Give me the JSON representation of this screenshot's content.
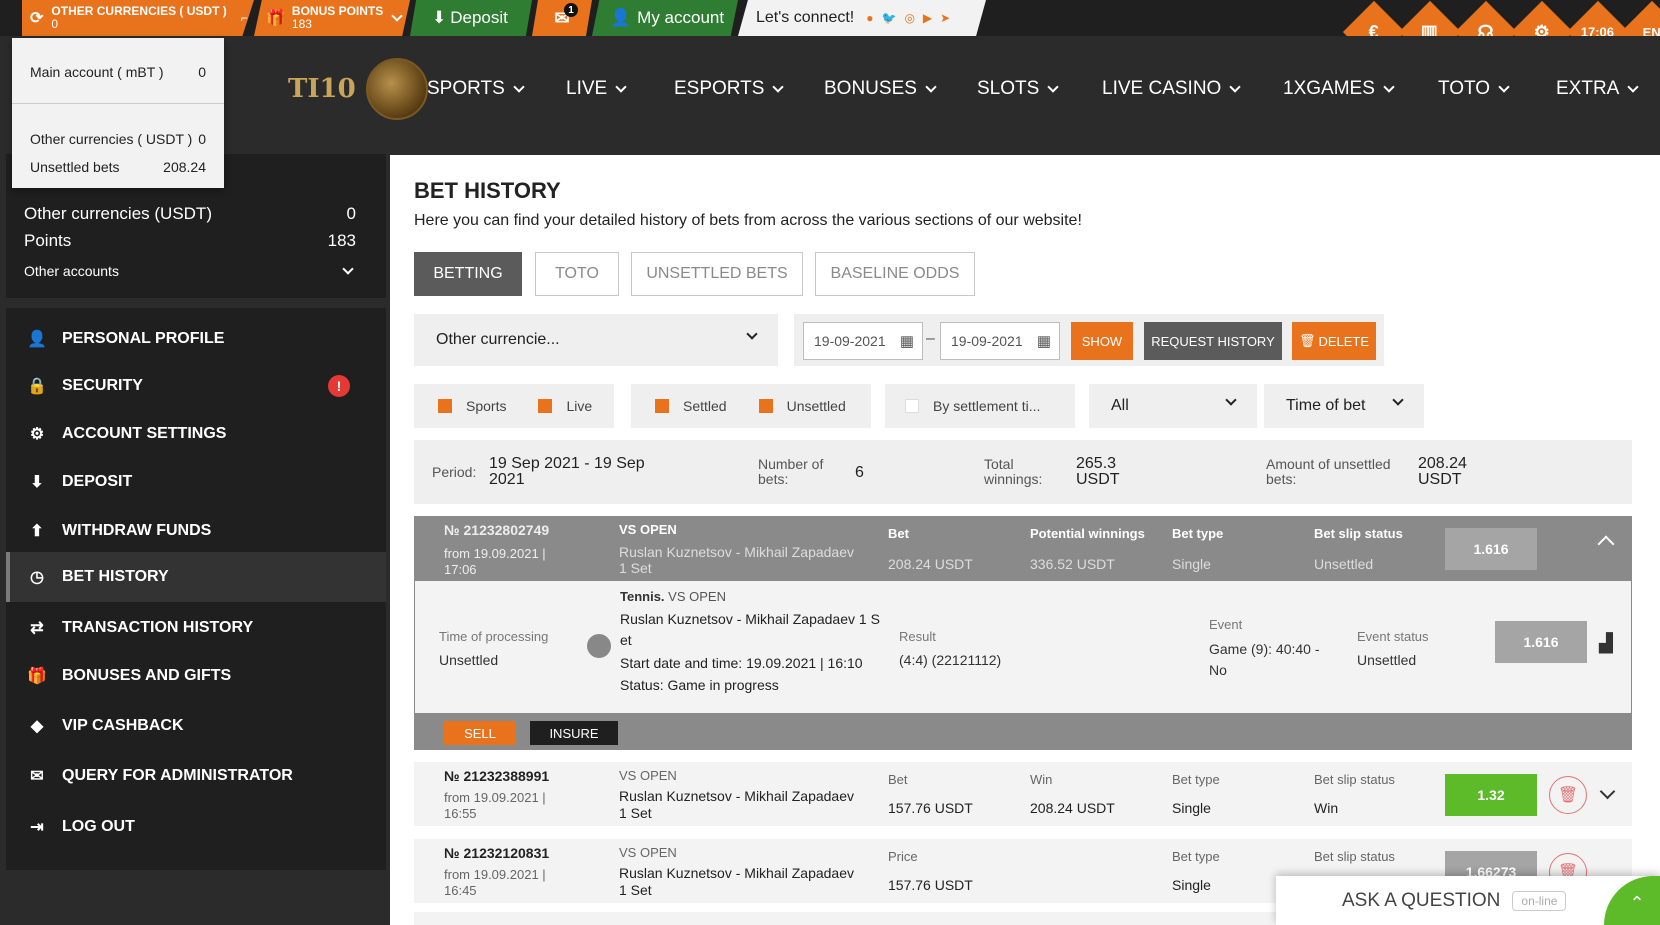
{
  "topbar": {
    "currencies_label": "OTHER CURRENCIES ( USDT )",
    "currencies_value": "0",
    "bonus_label": "BONUS POINTS",
    "bonus_value": "183",
    "deposit": "Deposit",
    "mail_badge": "1",
    "account": "My account",
    "connect": "Let's connect!",
    "corner": {
      "time": "17:06",
      "lang": "EN"
    }
  },
  "balance_dropdown": {
    "main_label": "Main account ( mBT )",
    "main_value": "0",
    "other_label": "Other currencies ( USDT )",
    "other_value": "0",
    "unsettled_label": "Unsettled bets",
    "unsettled_value": "208.24"
  },
  "logo": {
    "text": "TI10"
  },
  "menu": [
    "SPORTS",
    "LIVE",
    "ESPORTS",
    "BONUSES",
    "SLOTS",
    "LIVE CASINO",
    "1XGAMES",
    "TOTO",
    "EXTRA"
  ],
  "sidebar": {
    "other_currencies_label": "Other currencies (USDT)",
    "other_currencies_value": "0",
    "points_label": "Points",
    "points_value": "183",
    "other_accounts": "Other accounts",
    "items": [
      {
        "label": "Personal profile",
        "icon": "user-plus-icon"
      },
      {
        "label": "Security",
        "icon": "lock-icon"
      },
      {
        "label": "Account settings",
        "icon": "gears-icon"
      },
      {
        "label": "Deposit",
        "icon": "download-icon"
      },
      {
        "label": "Withdraw funds",
        "icon": "upload-icon"
      },
      {
        "label": "Bet history",
        "icon": "clock-icon"
      },
      {
        "label": "Transaction history",
        "icon": "arrows-icon"
      },
      {
        "label": "Bonuses and gifts",
        "icon": "gift-icon"
      },
      {
        "label": "VIP Cashback",
        "icon": "diamond-icon"
      },
      {
        "label": "Query for administrator",
        "icon": "envelope-icon"
      },
      {
        "label": "Log out",
        "icon": "logout-icon"
      }
    ],
    "security_alert": "!"
  },
  "page": {
    "title": "BET HISTORY",
    "subtitle": "Here you can find your detailed history of bets from across the various sections of our website!"
  },
  "tabs": [
    "BETTING",
    "TOTO",
    "UNSETTLED BETS",
    "BASELINE ODDS"
  ],
  "filters": {
    "currency": "Other currencie...",
    "date_from": "19-09-2021",
    "date_to": "19-09-2021",
    "show": "SHOW",
    "request_history": "REQUEST HISTORY",
    "delete": "DELETE",
    "sports": "Sports",
    "live": "Live",
    "settled": "Settled",
    "unsettled": "Unsettled",
    "by_settlement": "By settlement ti...",
    "all": "All",
    "time_of_bet": "Time of bet"
  },
  "summary": {
    "period_label": "Period:",
    "period_value": "19 Sep 2021 - 19 Sep 2021",
    "bets_label": "Number of bets:",
    "bets_value": "6",
    "winnings_label": "Total winnings:",
    "winnings_value": "265.3 USDT",
    "unsettled_label": "Amount of unsettled bets:",
    "unsettled_value": "208.24 USDT"
  },
  "bet1": {
    "number": "№ 21232802749",
    "date": "from 19.09.2021 | 17:06",
    "type_tag": "VS OPEN",
    "match": "Ruslan Kuznetsov - Mikhail Zapadaev 1 Set",
    "bet_label": "Bet",
    "bet_value": "208.24 USDT",
    "pw_label": "Potential winnings",
    "pw_value": "336.52 USDT",
    "bt_label": "Bet type",
    "bt_value": "Single",
    "status_label": "Bet slip status",
    "status_value": "Unsettled",
    "odds": "1.616",
    "detail": {
      "proc_label": "Time of processing",
      "proc_value": "Unsettled",
      "sport": "Tennis.",
      "tag": "VS OPEN",
      "match": "Ruslan Kuznetsov - Mikhail Zapadaev 1 Set",
      "start": "Start date and time: 19.09.2021 | 16:10",
      "status": "Status: Game in progress",
      "result_label": "Result",
      "result_value": "(4:4) (22121112)",
      "event_label": "Event",
      "event_value": "Game (9): 40:40 - No",
      "event_status_label": "Event status",
      "event_status_value": "Unsettled",
      "odds": "1.616"
    },
    "sell": "SELL",
    "insure": "INSURE"
  },
  "bet2": {
    "number": "№ 21232388991",
    "date": "from 19.09.2021 | 16:55",
    "type_tag": "VS OPEN",
    "match": "Ruslan Kuznetsov - Mikhail Zapadaev 1 Set",
    "bet_label": "Bet",
    "bet_value": "157.76 USDT",
    "win_label": "Win",
    "win_value": "208.24 USDT",
    "bt_label": "Bet type",
    "bt_value": "Single",
    "status_label": "Bet slip status",
    "status_value": "Win",
    "odds": "1.32"
  },
  "bet3": {
    "number": "№ 21232120831",
    "date": "from 19.09.2021 | 16:45",
    "type_tag": "VS OPEN",
    "match": "Ruslan Kuznetsov - Mikhail Zapadaev 1 Set",
    "price_label": "Price",
    "price_value": "157.76 USDT",
    "bt_label": "Bet type",
    "bt_value": "Single",
    "status_label": "Bet slip status",
    "odds": "1.66273"
  },
  "ask": {
    "label": "ASK A QUESTION",
    "status": "on-line"
  },
  "colors": {
    "accent": "#e8731c",
    "win": "#5dbb2a",
    "dark": "#1f1f1f",
    "gray": "#8a8a8a"
  }
}
